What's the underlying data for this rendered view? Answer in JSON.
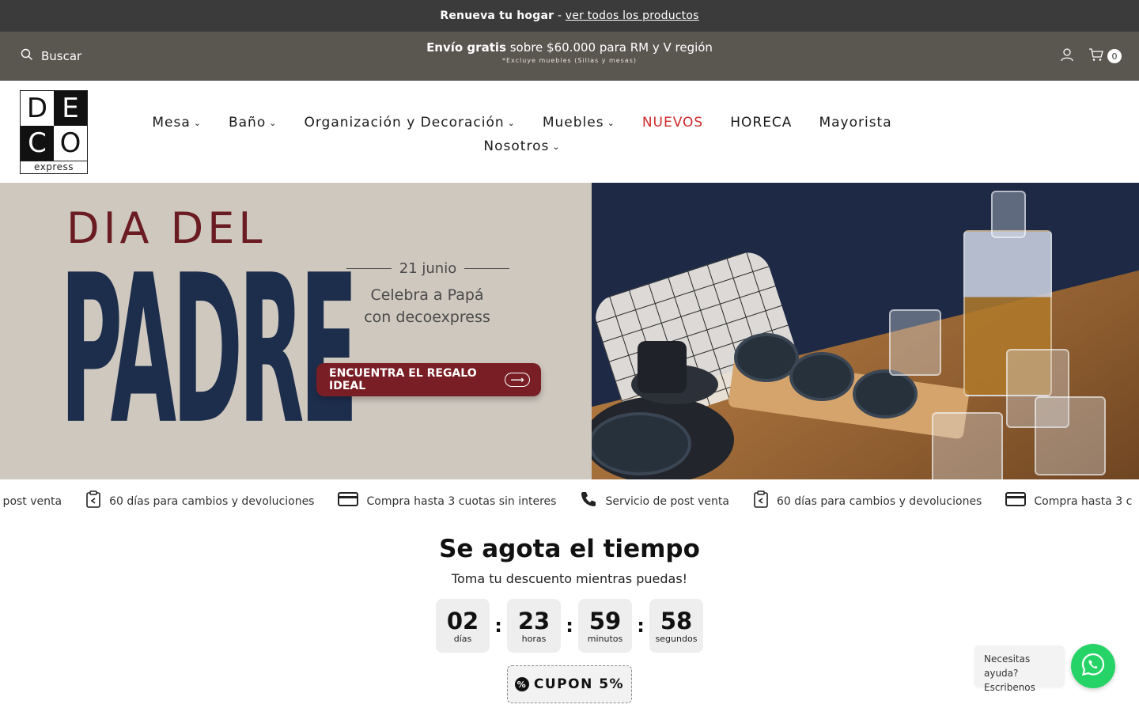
{
  "announcement": {
    "bold": "Renueva tu hogar",
    "separator": " - ",
    "link": "ver todos los productos"
  },
  "topbar": {
    "search_label": "Buscar",
    "promo_bold": "Envío gratis",
    "promo_rest": " sobre $60.000 para RM y V región",
    "promo_note": "*Excluye muebles (Sillas y mesas)",
    "cart_count": "0"
  },
  "logo": {
    "cells": [
      "D",
      "E",
      "C",
      "O"
    ],
    "sub": "express"
  },
  "nav": {
    "items": [
      {
        "label": "Mesa"
      },
      {
        "label": "Baño"
      },
      {
        "label": "Organización y Decoración"
      },
      {
        "label": "Muebles"
      },
      {
        "label": "NUEVOS"
      },
      {
        "label": "HORECA"
      },
      {
        "label": "Mayorista"
      },
      {
        "label": "Nosotros"
      }
    ]
  },
  "hero": {
    "dia": "DIA DEL",
    "padre": "PADRE",
    "date": "21 junio",
    "line1": "Celebra a Papá",
    "line2": "con decoexpress",
    "cta": "ENCUENTRA EL REGALO IDEAL"
  },
  "marquee": {
    "items": [
      {
        "icon": "phone-icon",
        "label": "cio de post venta"
      },
      {
        "icon": "return-icon",
        "label": "60 días para cambios y devoluciones"
      },
      {
        "icon": "card-icon",
        "label": "Compra hasta 3 cuotas sin interes"
      },
      {
        "icon": "phone-icon",
        "label": "Servicio de post venta"
      },
      {
        "icon": "return-icon",
        "label": "60 días para cambios y devoluciones"
      },
      {
        "icon": "card-icon",
        "label": "Compra hasta 3 c"
      }
    ]
  },
  "countdown": {
    "title": "Se agota el tiempo",
    "subtitle": "Toma tu descuento mientras puedas!",
    "units": [
      {
        "value": "02",
        "label": "días"
      },
      {
        "value": "23",
        "label": "horas"
      },
      {
        "value": "59",
        "label": "minutos"
      },
      {
        "value": "58",
        "label": "segundos"
      }
    ],
    "separator": ":",
    "coupon": "CUPON 5%"
  },
  "whatsapp": {
    "line1": "Necesitas ayuda?",
    "line2": "Escribenos"
  },
  "colors": {
    "announce_bg": "#3b3b3b",
    "topbar_bg": "#5a5650",
    "accent_red": "#cf2a2a",
    "cta_bg": "#7a1e26",
    "whatsapp": "#25d366"
  }
}
